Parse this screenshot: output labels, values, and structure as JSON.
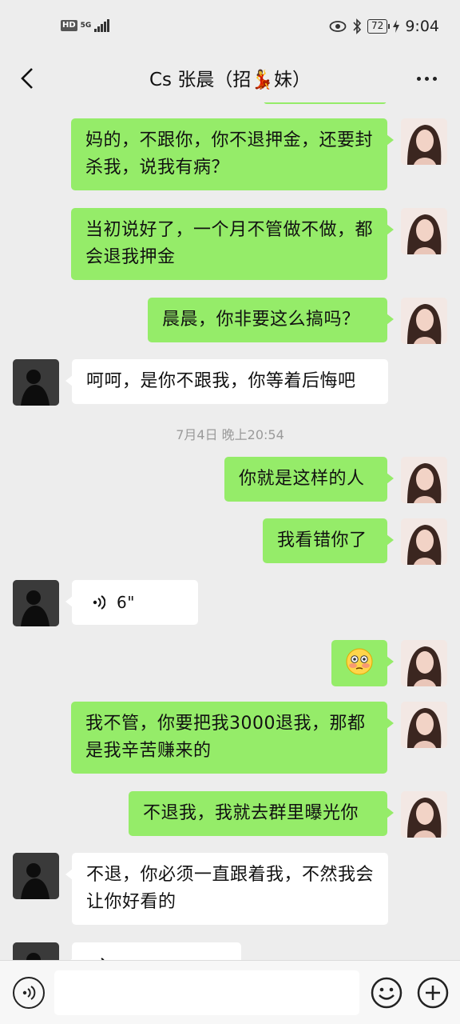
{
  "status_bar": {
    "hd": "HD",
    "network": "5G",
    "battery": "72",
    "time": "9:04"
  },
  "header": {
    "title": "Cs 张晨（招💃妹）"
  },
  "messages": [
    {
      "side": "me",
      "text": "妈的，不跟你，你不退押金，还要封杀我，说我有病？"
    },
    {
      "side": "me",
      "text": "当初说好了，一个月不管做不做，都会退我押金"
    },
    {
      "side": "me",
      "text": "晨晨，你非要这么搞吗？"
    },
    {
      "side": "other",
      "text": "呵呵，是你不跟我，你等着后悔吧"
    },
    {
      "type": "time",
      "text": "7月4日 晚上20:54"
    },
    {
      "side": "me",
      "text": "你就是这样的人"
    },
    {
      "side": "me",
      "text": "我看错你了"
    },
    {
      "side": "other",
      "type": "voice",
      "duration": "6\""
    },
    {
      "side": "me",
      "type": "emoji",
      "emoji": "😳"
    },
    {
      "side": "me",
      "text": "我不管，你要把我3000退我，那都是我辛苦赚来的"
    },
    {
      "side": "me",
      "text": "不退我，我就去群里曝光你"
    },
    {
      "side": "other",
      "text": "不退，你必须一直跟着我，不然我会让你好看的"
    },
    {
      "side": "other",
      "type": "voice",
      "duration": ""
    }
  ],
  "input": {
    "placeholder": ""
  },
  "colors": {
    "background": "#ededed",
    "my_bubble": "#95ec69",
    "other_bubble": "#ffffff"
  },
  "icons": {
    "back": "back-arrow-icon",
    "more": "more-dots-icon",
    "voice": "voice-icon",
    "emoji": "emoji-icon",
    "plus": "plus-icon"
  }
}
